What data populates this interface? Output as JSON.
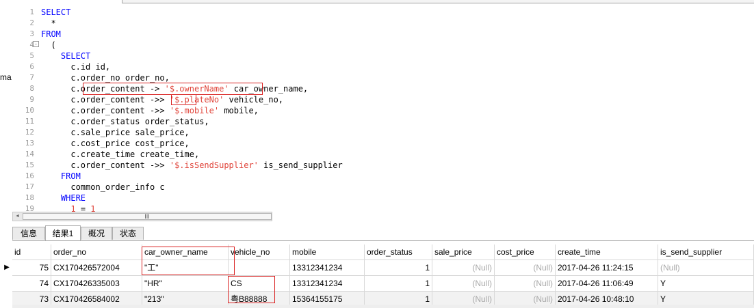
{
  "left_fragment": "ma",
  "editor": {
    "line_numbers": [
      "1",
      "2",
      "3",
      "4",
      "5",
      "6",
      "7",
      "8",
      "9",
      "10",
      "11",
      "12",
      "13",
      "14",
      "15",
      "16",
      "17",
      "18",
      "19"
    ],
    "fold_marker": "-",
    "lines": [
      [
        {
          "t": "SELECT",
          "c": "kw"
        }
      ],
      [
        {
          "t": "  *",
          "c": ""
        }
      ],
      [
        {
          "t": "FROM",
          "c": "kw"
        }
      ],
      [
        {
          "t": "  (",
          "c": ""
        }
      ],
      [
        {
          "t": "    ",
          "c": ""
        },
        {
          "t": "SELECT",
          "c": "kw"
        }
      ],
      [
        {
          "t": "      c.id id,",
          "c": ""
        }
      ],
      [
        {
          "t": "      c.order_no order_no,",
          "c": ""
        }
      ],
      [
        {
          "t": "      c.order_content -> ",
          "c": ""
        },
        {
          "t": "'$.ownerName'",
          "c": "str"
        },
        {
          "t": " car_owner_name,",
          "c": ""
        }
      ],
      [
        {
          "t": "      c.order_content ->> ",
          "c": ""
        },
        {
          "t": "'$.plateNo'",
          "c": "str"
        },
        {
          "t": " vehicle_no,",
          "c": ""
        }
      ],
      [
        {
          "t": "      c.order_content ->> ",
          "c": ""
        },
        {
          "t": "'$.mobile'",
          "c": "str"
        },
        {
          "t": " mobile,",
          "c": ""
        }
      ],
      [
        {
          "t": "      c.order_status order_status,",
          "c": ""
        }
      ],
      [
        {
          "t": "      c.sale_price sale_price,",
          "c": ""
        }
      ],
      [
        {
          "t": "      c.cost_price cost_price,",
          "c": ""
        }
      ],
      [
        {
          "t": "      c.create_time create_time,",
          "c": ""
        }
      ],
      [
        {
          "t": "      c.order_content ->> ",
          "c": ""
        },
        {
          "t": "'$.isSendSupplier'",
          "c": "str"
        },
        {
          "t": " is_send_supplier",
          "c": ""
        }
      ],
      [
        {
          "t": "    ",
          "c": ""
        },
        {
          "t": "FROM",
          "c": "kw"
        }
      ],
      [
        {
          "t": "      common_order_info c",
          "c": ""
        }
      ],
      [
        {
          "t": "    ",
          "c": ""
        },
        {
          "t": "WHERE",
          "c": "kw"
        }
      ],
      [
        {
          "t": "      ",
          "c": ""
        },
        {
          "t": "1",
          "c": "num"
        },
        {
          "t": " = ",
          "c": ""
        },
        {
          "t": "1",
          "c": "num"
        }
      ]
    ]
  },
  "scrollbar": {
    "thumb_grip": "III",
    "left_arrow": "◄"
  },
  "tabs": [
    {
      "label": "信息",
      "active": false
    },
    {
      "label": "结果1",
      "active": true
    },
    {
      "label": "概况",
      "active": false
    },
    {
      "label": "状态",
      "active": false
    }
  ],
  "grid": {
    "columns": [
      "id",
      "order_no",
      "car_owner_name",
      "vehicle_no",
      "mobile",
      "order_status",
      "sale_price",
      "cost_price",
      "create_time",
      "is_send_supplier"
    ],
    "rows": [
      [
        "75",
        "CX170426572004",
        "\"工\"",
        "",
        "13312341234",
        "1",
        "(Null)",
        "(Null)",
        "2017-04-26 11:24:15",
        "(Null)"
      ],
      [
        "74",
        "CX170426335003",
        "\"HR\"",
        "CS",
        "13312341234",
        "1",
        "(Null)",
        "(Null)",
        "2017-04-26 11:06:49",
        "Y"
      ],
      [
        "73",
        "CX170426584002",
        "\"213\"",
        "粤B88888",
        "15364155175",
        "1",
        "(Null)",
        "(Null)",
        "2017-04-26 10:48:10",
        "Y"
      ]
    ],
    "current_row_marker": "▶"
  },
  "colors": {
    "keyword": "#0000ff",
    "string": "#e0443a",
    "highlight_box": "#d92020",
    "null_text": "#a8a8a8"
  }
}
